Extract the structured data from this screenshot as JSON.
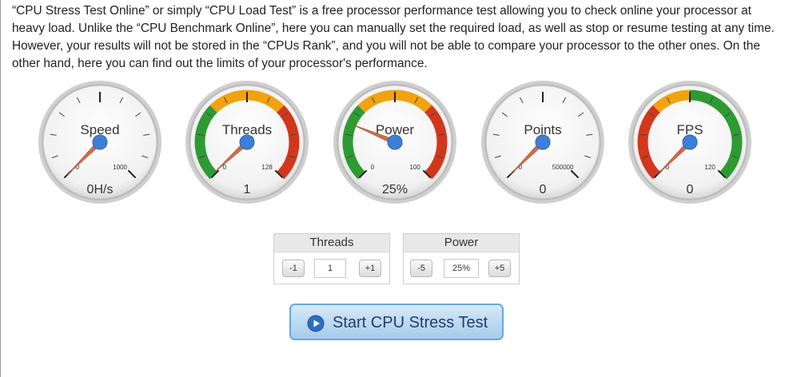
{
  "intro_text": "“CPU Stress Test Online” or simply “CPU Load Test” is a free processor performance test allowing you to check online your processor at heavy load. Unlike the “CPU Benchmark Online”, here you can manually set the required load, as well as stop or resume testing at any time. However, your results will not be stored in the “CPUs Rank”, and you will not be able to compare your processor to the other ones. On the other hand, here you can find out the limits of your processor's performance.",
  "gauges": [
    {
      "title": "Speed",
      "min": "0",
      "max": "1000",
      "value": "0H/s",
      "level": 0,
      "zones": "none"
    },
    {
      "title": "Threads",
      "min": "0",
      "max": "128",
      "value": "1",
      "level": 0.008,
      "zones": "threads"
    },
    {
      "title": "Power",
      "min": "0",
      "max": "100",
      "value": "25%",
      "level": 0.25,
      "zones": "threads"
    },
    {
      "title": "Points",
      "min": "0",
      "max": "500000",
      "value": "0",
      "level": 0,
      "zones": "none"
    },
    {
      "title": "FPS",
      "min": "0",
      "max": "120",
      "value": "0",
      "level": 0,
      "zones": "fps"
    }
  ],
  "colors": {
    "green": "#2e9b32",
    "orange": "#f2a20f",
    "red": "#d2371c",
    "needle": "#cd6d47",
    "hub": "#3d7fd6"
  },
  "threads_control": {
    "title": "Threads",
    "dec": "-1",
    "value": "1",
    "inc": "+1"
  },
  "power_control": {
    "title": "Power",
    "dec": "-5",
    "value": "25%",
    "inc": "+5"
  },
  "start_button": {
    "label": "Start CPU Stress Test",
    "icon": "play-icon"
  }
}
